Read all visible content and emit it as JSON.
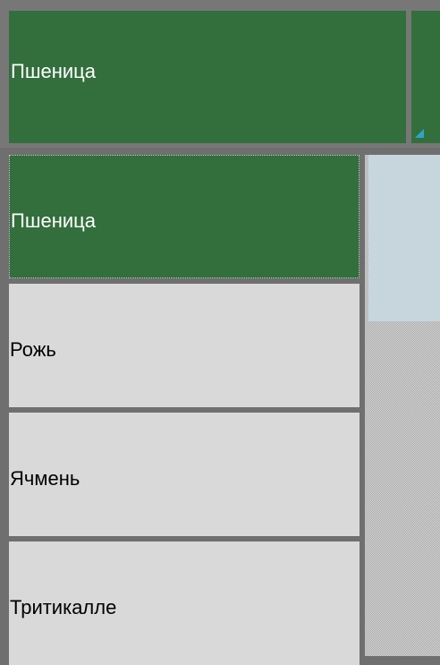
{
  "combo": {
    "selected_value": "Пшеница"
  },
  "list": {
    "items": [
      {
        "label": "Пшеница",
        "selected": true
      },
      {
        "label": "Рожь",
        "selected": false
      },
      {
        "label": "Ячмень",
        "selected": false
      },
      {
        "label": "Тритикалле",
        "selected": false
      }
    ]
  },
  "colors": {
    "accent": "#336e3d",
    "item_bg": "#d9d9d9",
    "arrow": "#2aa6c9",
    "scroll_thumb": "#c7d6dc"
  }
}
